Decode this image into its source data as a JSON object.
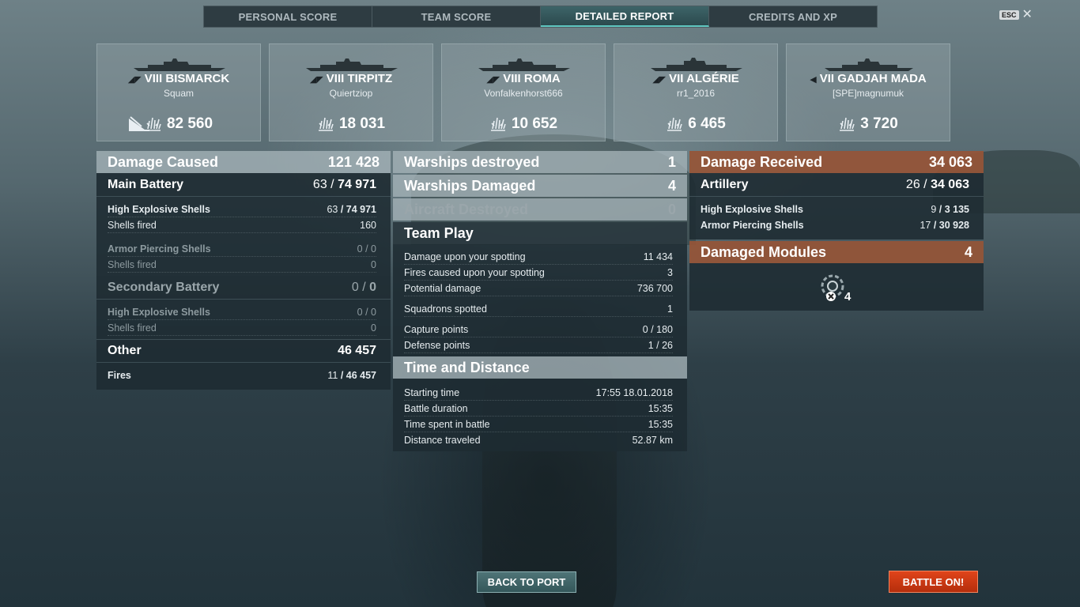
{
  "tabs": [
    {
      "label": "PERSONAL SCORE",
      "active": false
    },
    {
      "label": "TEAM SCORE",
      "active": false
    },
    {
      "label": "DETAILED REPORT",
      "active": true
    },
    {
      "label": "CREDITS AND XP",
      "active": false
    }
  ],
  "close": {
    "key_label": "ESC",
    "icon": "close-icon"
  },
  "ships": [
    {
      "tier": "VIII",
      "name": "BISMARCK",
      "player": "Squam",
      "damage": "82 560",
      "sunk": true
    },
    {
      "tier": "VIII",
      "name": "TIRPITZ",
      "player": "Quiertziop",
      "damage": "18 031",
      "sunk": false
    },
    {
      "tier": "VIII",
      "name": "ROMA",
      "player": "Vonfalkenhorst666",
      "damage": "10 652",
      "sunk": false
    },
    {
      "tier": "VII",
      "name": "ALGÉRIE",
      "player": "rr1_2016",
      "damage": "6 465",
      "sunk": false
    },
    {
      "tier": "VII",
      "name": "GADJAH MADA",
      "player": "[SPE]magnumuk",
      "damage": "3 720",
      "sunk": false
    }
  ],
  "damage_caused": {
    "title": "Damage Caused",
    "total": "121 428",
    "main_battery": {
      "label": "Main Battery",
      "hits": "63",
      "damage": "74 971"
    },
    "he_main": {
      "label": "High Explosive Shells",
      "hits": "63",
      "damage": "74 971",
      "fired_label": "Shells fired",
      "fired": "160"
    },
    "ap_main": {
      "label": "Armor Piercing Shells",
      "hits": "0",
      "damage": "0",
      "fired_label": "Shells fired",
      "fired": "0"
    },
    "secondary": {
      "label": "Secondary Battery",
      "hits": "0",
      "damage": "0"
    },
    "he_secondary": {
      "label": "High Explosive Shells",
      "hits": "0",
      "damage": "0",
      "fired_label": "Shells fired",
      "fired": "0"
    },
    "other": {
      "label": "Other",
      "damage": "46 457"
    },
    "fires": {
      "label": "Fires",
      "hits": "11",
      "damage": "46 457"
    }
  },
  "middle": {
    "warships_destroyed": {
      "label": "Warships destroyed",
      "value": "1"
    },
    "warships_damaged": {
      "label": "Warships Damaged",
      "value": "4"
    },
    "aircraft_destroyed": {
      "label": "Aircraft Destroyed",
      "value": "0"
    },
    "team_play": {
      "title": "Team Play",
      "spotting_damage": {
        "label": "Damage upon your spotting",
        "value": "11 434"
      },
      "spotting_fires": {
        "label": "Fires caused upon your spotting",
        "value": "3"
      },
      "potential": {
        "label": "Potential damage",
        "value": "736 700"
      },
      "squadrons": {
        "label": "Squadrons spotted",
        "value": "1"
      },
      "capture": {
        "label": "Capture points",
        "value": "0 / 180"
      },
      "defense": {
        "label": "Defense points",
        "value": "1 / 26"
      }
    },
    "time": {
      "title": "Time and Distance",
      "start": {
        "label": "Starting time",
        "value": "17:55  18.01.2018"
      },
      "duration": {
        "label": "Battle duration",
        "value": "15:35"
      },
      "spent": {
        "label": "Time spent in battle",
        "value": "15:35"
      },
      "distance": {
        "label": "Distance traveled",
        "value": "52.87 km"
      }
    }
  },
  "damage_received": {
    "title": "Damage Received",
    "total": "34 063",
    "artillery": {
      "label": "Artillery",
      "hits": "26",
      "damage": "34 063"
    },
    "he": {
      "label": "High Explosive Shells",
      "hits": "9",
      "damage": "3 135"
    },
    "ap": {
      "label": "Armor Piercing Shells",
      "hits": "17",
      "damage": "30 928"
    },
    "modules": {
      "title": "Damaged Modules",
      "value": "4",
      "icon": "damaged-module-icon",
      "count": "4"
    }
  },
  "buttons": {
    "back": "BACK TO PORT",
    "battle": "BATTLE ON!"
  },
  "colors": {
    "accent_teal": "#5fc6c0",
    "battle_orange": "#d43c15",
    "received_header": "#96553a"
  }
}
